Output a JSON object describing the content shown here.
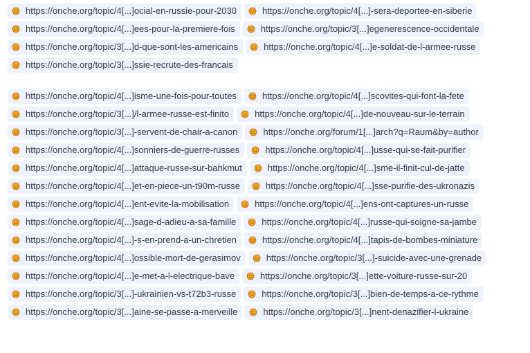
{
  "colors": {
    "chip_background": "#eef2fb",
    "chip_text": "#363b49",
    "favicon_fill": "#f5a623",
    "favicon_stroke": "#b06b12"
  },
  "favicon_icon": "onche-smiley-icon",
  "groups": [
    {
      "links": [
        "https://onche.org/topic/4[...]ocial-en-russie-pour-2030",
        "https://onche.org/topic/4[...]-sera-deportee-en-siberie",
        "https://onche.org/topic/4[...]ees-pour-la-premiere-fois",
        "https://onche.org/topic/3[...]egenerescence-occidentale",
        "https://onche.org/topic/3[...]d-que-sont-les-americains",
        "https://onche.org/topic/4[...]e-soldat-de-l-armee-russe",
        "https://onche.org/topic/3[...]ssie-recrute-des-francais"
      ]
    },
    {
      "links": [
        "https://onche.org/topic/4[...]isme-une-fois-pour-toutes",
        "https://onche.org/topic/4[...]scovites-qui-font-la-fete",
        "https://onche.org/topic/3[...]/l-armee-russe-est-finito",
        "https://onche.org/topic/4[...]de-nouveau-sur-le-terrain",
        "https://onche.org/topic/3[...]-servent-de-chair-a-canon",
        "https://onche.org/forum/1[...]arch?q=Raum&by=author",
        "https://onche.org/topic/4[...]sonniers-de-guerre-russes",
        "https://onche.org/topic/4[...]usse-qui-se-fait-purifier",
        "https://onche.org/topic/4[...]attaque-russe-sur-bahkmut",
        "https://onche.org/topic/4[...]sme-il-finit-cul-de-jatte",
        "https://onche.org/topic/4[...]et-en-piece-un-t90m-russe",
        "https://onche.org/topic/4[...]sse-purifie-des-ukronazis",
        "https://onche.org/topic/4[...]ent-evite-la-mobilisation",
        "https://onche.org/topic/4[...]ens-ont-captures-un-russe",
        "https://onche.org/topic/4[...]sage-d-adieu-a-sa-famille",
        "https://onche.org/topic/4[...]russe-qui-soigne-sa-jambe",
        "https://onche.org/topic/4[...]-s-en-prend-a-un-chretien",
        "https://onche.org/topic/4[...]tapis-de-bombes-miniature",
        "https://onche.org/topic/4[...]ossible-mort-de-gerasimov",
        "https://onche.org/topic/3[...]-suicide-avec-une-grenade",
        "https://onche.org/topic/4[...]e-met-a-l-electrique-bave",
        "https://onche.org/topic/3[...]ette-voiture-russe-sur-20",
        "https://onche.org/topic/3[...]-ukrainien-vs-t72b3-russe",
        "https://onche.org/topic/3[...]bien-de-temps-a-ce-rythme",
        "https://onche.org/topic/3[...]aine-se-passe-a-merveille",
        "https://onche.org/topic/3[...]nent-denazifier-l-ukraine"
      ]
    }
  ]
}
